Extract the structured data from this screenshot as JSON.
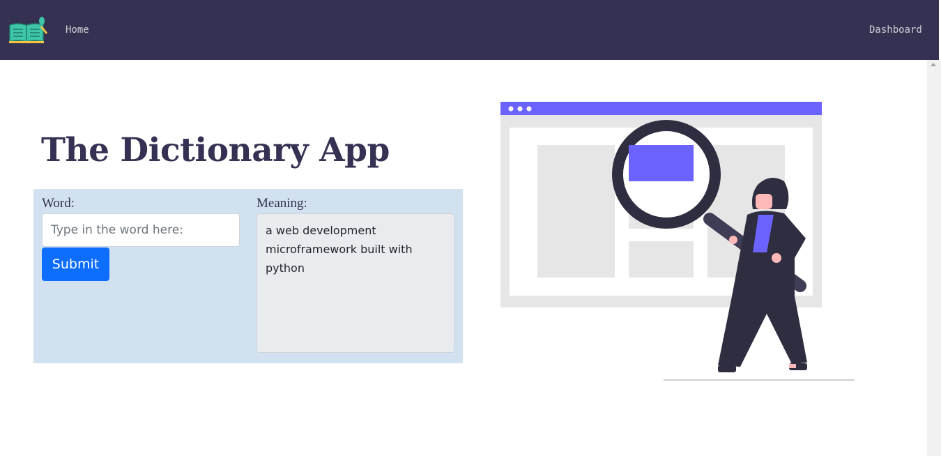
{
  "nav": {
    "home_label": "Home",
    "dashboard_label": "Dashboard",
    "logo_icon": "open-book-icon"
  },
  "main": {
    "title": "The Dictionary App",
    "word_label": "Word:",
    "word_placeholder": "Type in the word here:",
    "word_value": "",
    "submit_label": "Submit",
    "meaning_label": "Meaning:",
    "meaning_value": "a web development microframework built with python"
  },
  "colors": {
    "navbar": "#343152",
    "panel": "#d1e1ef",
    "button": "#0d6efd",
    "accent": "#6c63ff"
  },
  "illustration": {
    "icon": "woman-with-magnifying-glass-illustration"
  }
}
